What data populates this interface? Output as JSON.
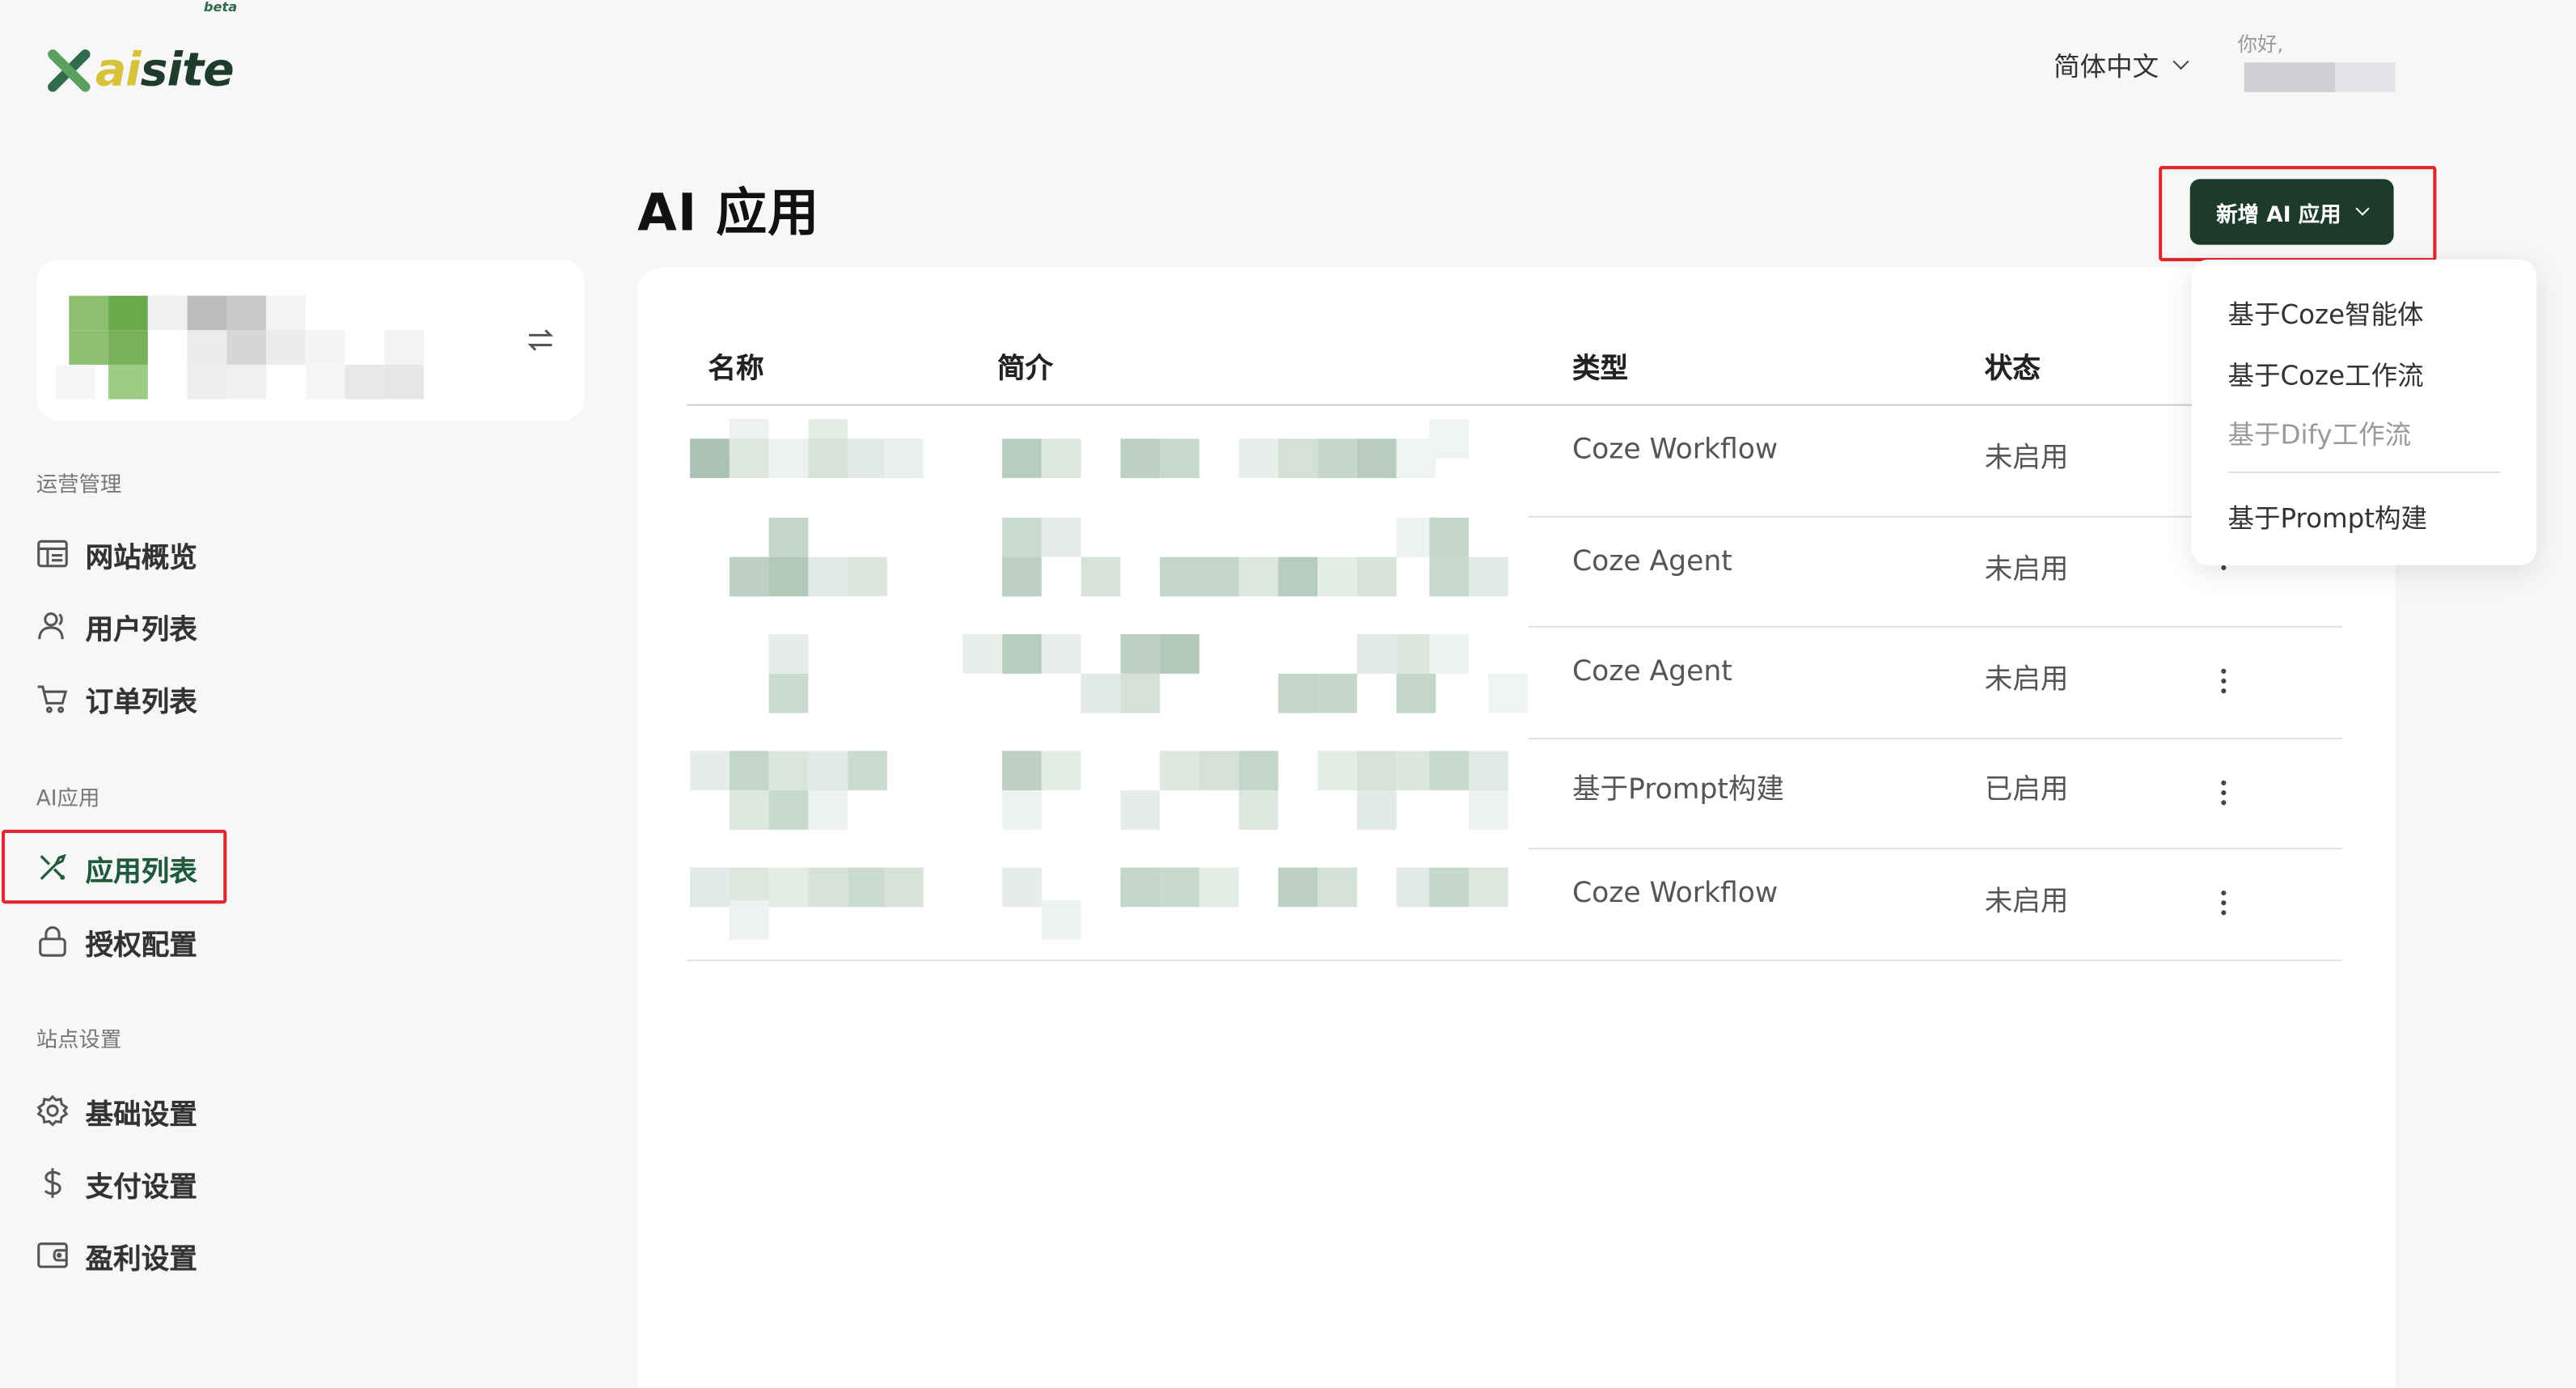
{
  "logo": {
    "ai": "ai",
    "site": "site",
    "beta": "beta"
  },
  "header": {
    "language": "简体中文",
    "greeting": "你好,"
  },
  "sidebar": {
    "sections": [
      {
        "label": "运营管理",
        "items": [
          "网站概览",
          "用户列表",
          "订单列表"
        ]
      },
      {
        "label": "AI应用",
        "items": [
          "应用列表",
          "授权配置"
        ]
      },
      {
        "label": "站点设置",
        "items": [
          "基础设置",
          "支付设置",
          "盈利设置"
        ]
      }
    ],
    "active_item": "应用列表"
  },
  "main": {
    "title": "AI 应用",
    "new_button": "新增 AI 应用",
    "columns": [
      "名称",
      "简介",
      "类型",
      "状态"
    ],
    "rows": [
      {
        "type": "Coze Workflow",
        "status": "未启用"
      },
      {
        "type": "Coze Agent",
        "status": "未启用"
      },
      {
        "type": "Coze Agent",
        "status": "未启用"
      },
      {
        "type": "基于Prompt构建",
        "status": "已启用"
      },
      {
        "type": "Coze Workflow",
        "status": "未启用"
      }
    ]
  },
  "dropdown": {
    "items": [
      {
        "label": "基于Coze智能体",
        "disabled": false
      },
      {
        "label": "基于Coze工作流",
        "disabled": false
      },
      {
        "label": "基于Dify工作流",
        "disabled": true
      },
      {
        "label": "基于Prompt构建",
        "disabled": false
      }
    ]
  },
  "colors": {
    "brand_dark": "#1d3b2b",
    "brand_green": "#5aa05f",
    "brand_yellow": "#d8c23a",
    "highlight_red": "#e0262e"
  },
  "icons": {
    "nav": [
      "dashboard-icon",
      "users-icon",
      "cart-icon",
      "tools-icon",
      "lock-icon",
      "gear-icon",
      "dollar-icon",
      "wallet-icon"
    ]
  }
}
